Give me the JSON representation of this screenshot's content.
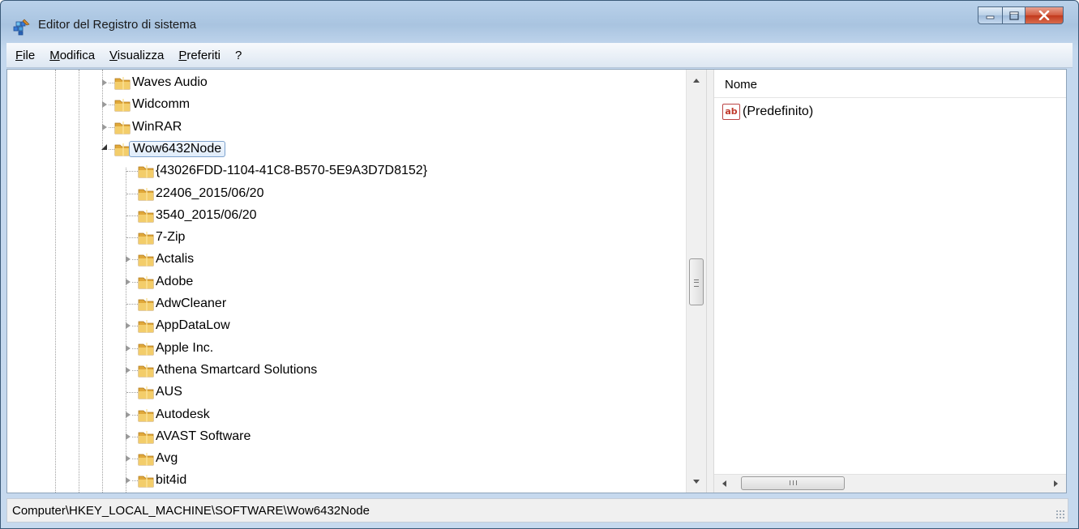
{
  "window": {
    "title": "Editor del Registro di sistema",
    "icon": "registry-editor-icon"
  },
  "caption_buttons": {
    "minimize_icon": "minimize-icon",
    "maximize_icon": "maximize-icon",
    "close_icon": "close-icon"
  },
  "menu": {
    "items": [
      "File",
      "Modifica",
      "Visualizza",
      "Preferiti",
      "?"
    ]
  },
  "tree": {
    "items": [
      {
        "label": "Waves Audio",
        "expander": "collapsed"
      },
      {
        "label": "Widcomm",
        "expander": "collapsed"
      },
      {
        "label": "WinRAR",
        "expander": "collapsed"
      },
      {
        "label": "Wow6432Node",
        "expander": "expanded",
        "selected": true
      },
      {
        "label": "{43026FDD-1104-41C8-B570-5E9A3D7D8152}",
        "expander": "none"
      },
      {
        "label": "22406_2015/06/20",
        "expander": "none"
      },
      {
        "label": "3540_2015/06/20",
        "expander": "none"
      },
      {
        "label": "7-Zip",
        "expander": "none"
      },
      {
        "label": "Actalis",
        "expander": "collapsed"
      },
      {
        "label": "Adobe",
        "expander": "collapsed"
      },
      {
        "label": "AdwCleaner",
        "expander": "none"
      },
      {
        "label": "AppDataLow",
        "expander": "collapsed"
      },
      {
        "label": "Apple Inc.",
        "expander": "collapsed"
      },
      {
        "label": "Athena Smartcard Solutions",
        "expander": "collapsed"
      },
      {
        "label": "AUS",
        "expander": "none"
      },
      {
        "label": "Autodesk",
        "expander": "collapsed"
      },
      {
        "label": "AVAST Software",
        "expander": "collapsed"
      },
      {
        "label": "Avg",
        "expander": "collapsed"
      },
      {
        "label": "bit4id",
        "expander": "collapsed"
      }
    ]
  },
  "values_pane": {
    "column_header": "Nome",
    "values": [
      {
        "name": "(Predefinito)",
        "type_icon": "string-value-icon",
        "icon_text": "ab"
      }
    ],
    "hscroll_grip": "III"
  },
  "statusbar": {
    "path": "Computer\\HKEY_LOCAL_MACHINE\\SOFTWARE\\Wow6432Node"
  },
  "colors": {
    "folder": "#e8b84a",
    "selection_border": "#7da2ce",
    "close_button": "#c2391c"
  }
}
